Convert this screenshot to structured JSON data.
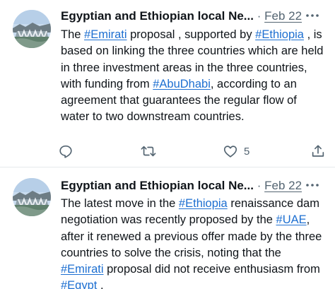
{
  "tweets": [
    {
      "author": "Egyptian and Ethiopian local Ne...",
      "separator": "·",
      "date": "Feb 22",
      "body": [
        {
          "text": "The "
        },
        {
          "text": "#Emirati",
          "tag": true
        },
        {
          "text": " proposal , supported by "
        },
        {
          "text": "#Ethiopia",
          "tag": true
        },
        {
          "text": " , is based on linking the three countries which are held in three investment areas in the three countries, with funding from "
        },
        {
          "text": "#AbuDhabi",
          "tag": true
        },
        {
          "text": ", according to an agreement that guarantees the regular flow of water to two downstream countries."
        }
      ],
      "like_count": "5",
      "icons": {
        "more": "more-horizontal-icon",
        "reply": "reply-icon",
        "retweet": "retweet-icon",
        "like": "heart-icon",
        "share": "share-icon"
      }
    },
    {
      "author": "Egyptian and Ethiopian local Ne...",
      "separator": "·",
      "date": "Feb 22",
      "body": [
        {
          "text": "The latest move in the "
        },
        {
          "text": "#Ethiopia",
          "tag": true
        },
        {
          "text": " renaissance dam negotiation  was recently proposed by the "
        },
        {
          "text": "#UAE",
          "tag": true
        },
        {
          "text": ", after it renewed a previous offer made by the three countries to solve the crisis, noting that the "
        },
        {
          "text": "#Emirati",
          "tag": true
        },
        {
          "text": " proposal did not receive enthusiasm from "
        },
        {
          "text": "#Egypt",
          "tag": true
        },
        {
          "text": " ."
        }
      ]
    }
  ],
  "colors": {
    "hashtag": "#1d6fd1",
    "muted": "#536471",
    "text": "#0f1419",
    "divider": "#e6e9ec"
  }
}
